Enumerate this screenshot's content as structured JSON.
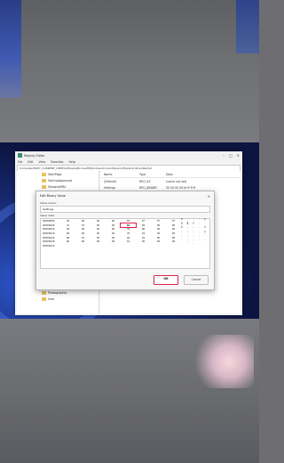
{
  "regedit": {
    "title": "Registry Editor",
    "menu": [
      "File",
      "Edit",
      "View",
      "Favorites",
      "Help"
    ],
    "address": "Computer\\HKEY_CURRENT_USER\\Software\\Microsoft\\Windows\\CurrentVersion\\Explorer\\StuckRects3",
    "tree": [
      "StartPage",
      "StartupApproved",
      "StreamsMRU",
      "",
      "",
      "",
      "",
      "",
      "",
      "",
      "",
      "",
      "",
      "",
      "",
      "",
      "",
      "",
      "",
      "Photographer",
      "User"
    ],
    "columns": [
      "Name",
      "Type",
      "Data"
    ],
    "rows": [
      {
        "name": "(Default)",
        "type": "REG_SZ",
        "data": "(value not set)"
      },
      {
        "name": "Settings",
        "type": "REG_BINARY",
        "data": "30 00 00 00 fe ff ff ff"
      }
    ]
  },
  "dialog": {
    "title": "Edit Binary Value",
    "value_name_label": "Value name:",
    "value_name": "Settings",
    "value_data_label": "Value data:",
    "hex_rows": [
      {
        "addr": "00000000",
        "bytes": [
          "30",
          "00",
          "00",
          "00",
          "FE",
          "FF",
          "FF",
          "FF"
        ],
        "ascii": "0 . . . þ ÿ ÿ ÿ"
      },
      {
        "addr": "00000008",
        "bytes": [
          "7A",
          "F4",
          "00",
          "00",
          "01",
          "00",
          "00",
          "00"
        ],
        "ascii": "z ô . . . . . ."
      },
      {
        "addr": "00000010",
        "bytes": [
          "30",
          "00",
          "00",
          "00",
          "30",
          "00",
          "00",
          "00"
        ],
        "ascii": "0 . . . 0 . . ."
      },
      {
        "addr": "00000018",
        "bytes": [
          "00",
          "00",
          "00",
          "00",
          "70",
          "04",
          "00",
          "00"
        ],
        "ascii": ". . . . p . . ."
      },
      {
        "addr": "00000020",
        "bytes": [
          "80",
          "07",
          "00",
          "00",
          "A8",
          "04",
          "00",
          "00"
        ],
        "ascii": ". . . . ¨ . . ."
      },
      {
        "addr": "00000028",
        "bytes": [
          "60",
          "00",
          "00",
          "00",
          "01",
          "00",
          "00",
          "00"
        ],
        "ascii": "` . . . . . . ."
      },
      {
        "addr": "00000030",
        "bytes": [
          "",
          "",
          "",
          "",
          "",
          "",
          "",
          ""
        ],
        "ascii": ""
      }
    ],
    "selected_byte": {
      "row": 1,
      "col": 4
    },
    "ok_label": "OK",
    "cancel_label": "Cancel"
  }
}
